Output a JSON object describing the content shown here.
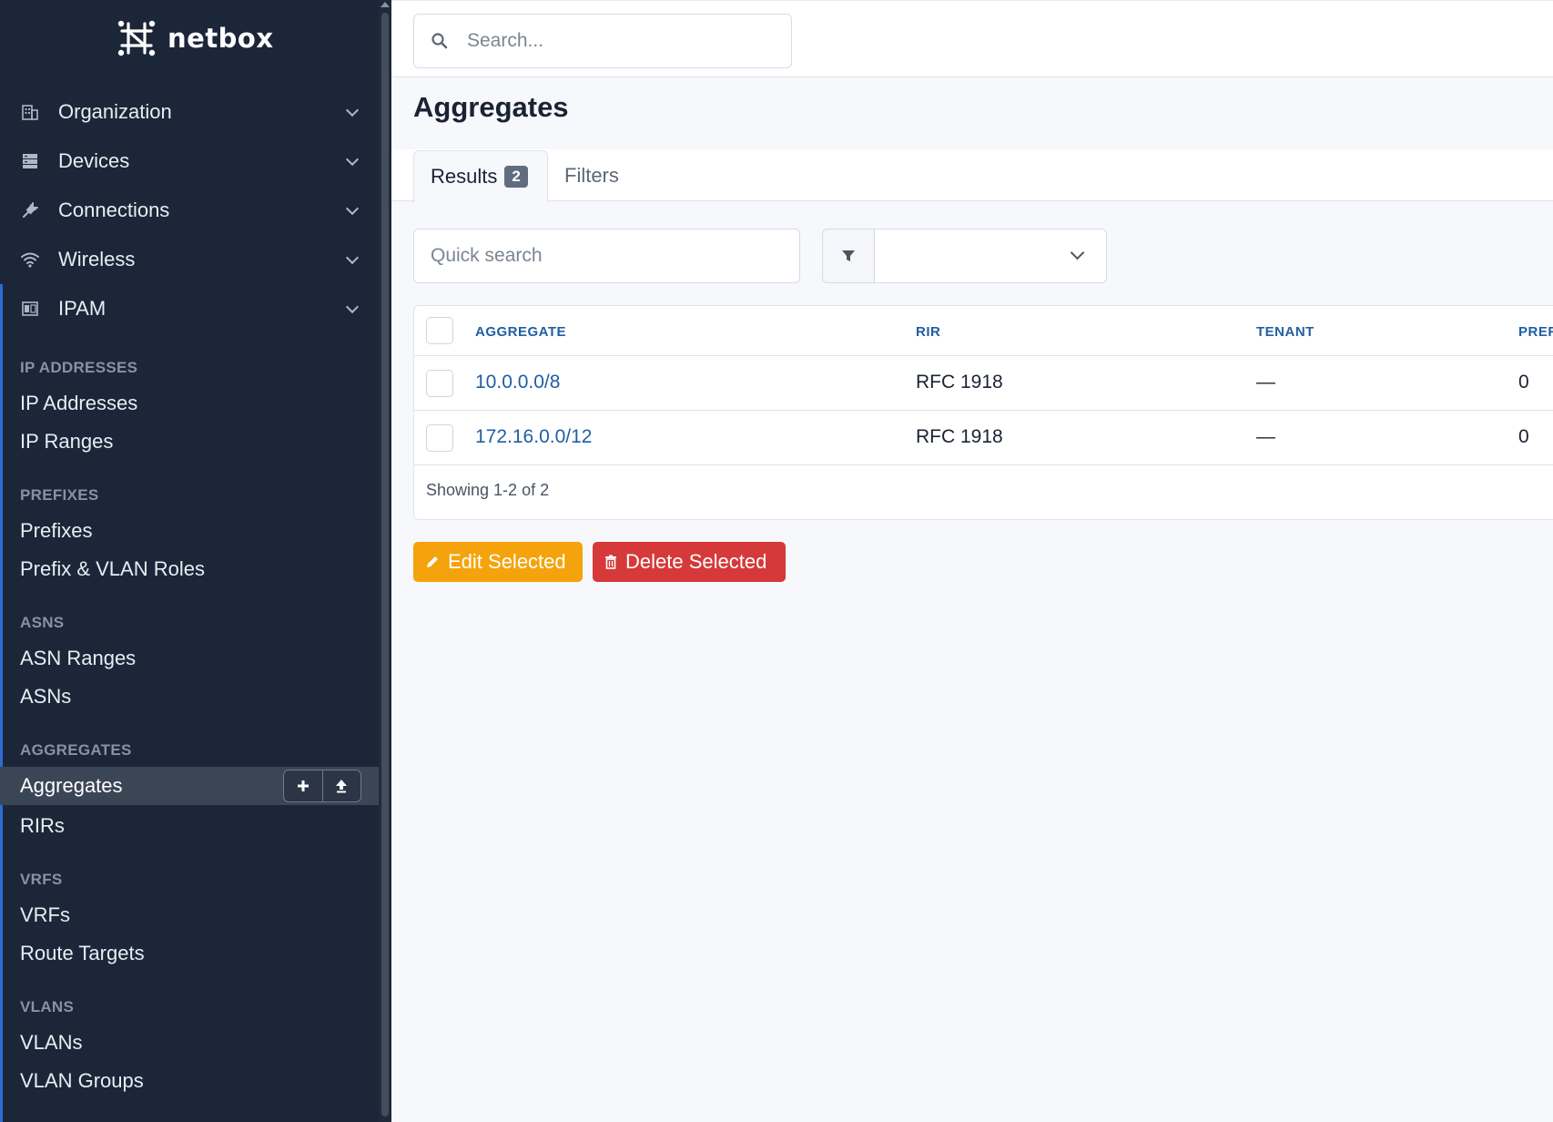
{
  "brand": {
    "name": "netbox"
  },
  "search": {
    "placeholder": "Search..."
  },
  "sidebar": {
    "menus": [
      {
        "label": "Organization",
        "icon": "building-icon"
      },
      {
        "label": "Devices",
        "icon": "server-icon"
      },
      {
        "label": "Connections",
        "icon": "plug-icon"
      },
      {
        "label": "Wireless",
        "icon": "wifi-icon"
      },
      {
        "label": "IPAM",
        "icon": "counter-icon"
      }
    ],
    "sections": [
      {
        "heading": "IP ADDRESSES",
        "items": [
          "IP Addresses",
          "IP Ranges"
        ]
      },
      {
        "heading": "PREFIXES",
        "items": [
          "Prefixes",
          "Prefix & VLAN Roles"
        ]
      },
      {
        "heading": "ASNS",
        "items": [
          "ASN Ranges",
          "ASNs"
        ]
      },
      {
        "heading": "AGGREGATES",
        "items": [
          "Aggregates",
          "RIRs"
        ]
      },
      {
        "heading": "VRFS",
        "items": [
          "VRFs",
          "Route Targets"
        ]
      },
      {
        "heading": "VLANS",
        "items": [
          "VLANs",
          "VLAN Groups"
        ]
      }
    ],
    "active_item": "Aggregates",
    "accent_color": "#2f6bd6"
  },
  "page": {
    "title": "Aggregates",
    "tabs": {
      "results": "Results",
      "results_count": "2",
      "filters": "Filters"
    },
    "quick_search_placeholder": "Quick search"
  },
  "table": {
    "columns": [
      "AGGREGATE",
      "RIR",
      "TENANT",
      "PREF"
    ],
    "rows": [
      {
        "aggregate": "10.0.0.0/8",
        "rir": "RFC 1918",
        "tenant": "—",
        "prefix": "0"
      },
      {
        "aggregate": "172.16.0.0/12",
        "rir": "RFC 1918",
        "tenant": "—",
        "prefix": "0"
      }
    ],
    "footer": "Showing 1-2 of 2"
  },
  "actions": {
    "edit_label": "Edit Selected",
    "delete_label": "Delete Selected",
    "edit_color": "#f5a30c",
    "delete_color": "#d63939"
  }
}
